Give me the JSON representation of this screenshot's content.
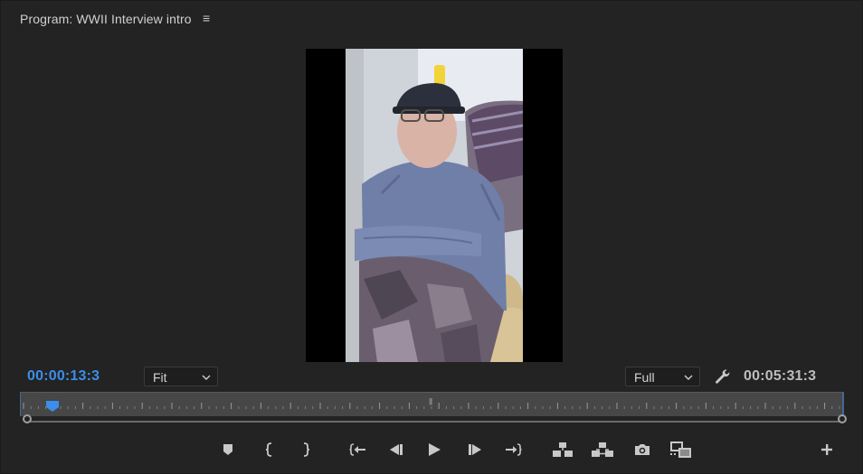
{
  "panel": {
    "title": "Program: WWII Interview intro",
    "menu_icon": "hamburger-menu-icon"
  },
  "timecode": {
    "current": "00:00:13:3",
    "duration": "00:05:31:3",
    "current_color": "#3b8eea"
  },
  "zoom": {
    "selected": "Fit"
  },
  "resolution": {
    "selected": "Full"
  },
  "settings_icon": "wrench-icon",
  "playback": {
    "position_fraction": 0.04
  },
  "controls": [
    {
      "name": "add-marker-button",
      "icon": "marker-icon"
    },
    {
      "name": "mark-in-button",
      "icon": "mark-in-icon"
    },
    {
      "name": "mark-out-button",
      "icon": "mark-out-icon"
    },
    {
      "name": "go-to-in-button",
      "icon": "go-to-in-icon"
    },
    {
      "name": "step-back-button",
      "icon": "step-back-icon"
    },
    {
      "name": "play-button",
      "icon": "play-icon"
    },
    {
      "name": "step-forward-button",
      "icon": "step-forward-icon"
    },
    {
      "name": "go-to-out-button",
      "icon": "go-to-out-icon"
    },
    {
      "name": "lift-button",
      "icon": "lift-icon"
    },
    {
      "name": "extract-button",
      "icon": "extract-icon"
    },
    {
      "name": "export-frame-button",
      "icon": "camera-icon"
    },
    {
      "name": "comparison-view-button",
      "icon": "comparison-view-icon"
    },
    {
      "name": "button-editor-button",
      "icon": "plus-icon"
    }
  ],
  "colors": {
    "panel_bg": "#232323",
    "accent": "#3b8eea",
    "ruler_bg": "#474747"
  }
}
